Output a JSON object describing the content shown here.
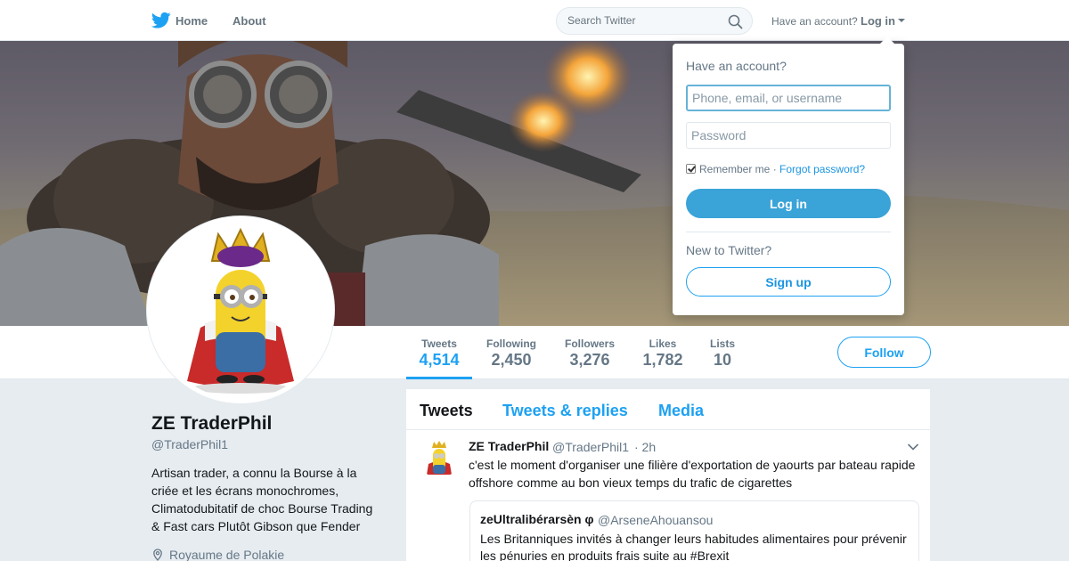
{
  "topnav": {
    "home": "Home",
    "about": "About",
    "search_placeholder": "Search Twitter",
    "have_account": "Have an account?",
    "login": "Log in"
  },
  "profile_nav": {
    "stats": [
      {
        "label": "Tweets",
        "value": "4,514"
      },
      {
        "label": "Following",
        "value": "2,450"
      },
      {
        "label": "Followers",
        "value": "3,276"
      },
      {
        "label": "Likes",
        "value": "1,782"
      },
      {
        "label": "Lists",
        "value": "10"
      }
    ],
    "follow_label": "Follow"
  },
  "profile": {
    "name": "ZE TraderPhil",
    "handle": "@TraderPhil1",
    "bio": "Artisan trader, a connu la Bourse à la criée et les écrans monochromes, Climatodubitatif de choc Bourse Trading & Fast cars Plutôt Gibson que Fender",
    "location": "Royaume de Polakie"
  },
  "timeline": {
    "tabs": [
      "Tweets",
      "Tweets & replies",
      "Media"
    ],
    "tweet": {
      "name": "ZE TraderPhil",
      "handle": "@TraderPhil1",
      "time": "· 2h",
      "text": "c'est le moment d'organiser une filière d'exportation de yaourts par bateau rapide offshore comme au bon vieux temps du trafic de cigarettes",
      "quote": {
        "name": "zeUltralibérarsèn φ",
        "handle": "@ArseneAhouansou",
        "text": "Les Britanniques invités à changer leurs habitudes alimentaires pour prévenir les pénuries en produits frais suite au #Brexit"
      }
    }
  },
  "login_dropdown": {
    "title": "Have an account?",
    "username_placeholder": "Phone, email, or username",
    "password_placeholder": "Password",
    "remember": "Remember me",
    "separator": "·",
    "forgot": "Forgot password?",
    "login_button": "Log in",
    "new_to": "New to Twitter?",
    "signup_button": "Sign up"
  },
  "colors": {
    "accent": "#1da1f2",
    "login_button": "#3aa3d8",
    "page_background": "#e6ecf0"
  },
  "icons": [
    "twitter-bird-icon",
    "search-icon",
    "caret-down-icon",
    "location-pin-icon",
    "chevron-down-icon",
    "checkbox-icon"
  ]
}
